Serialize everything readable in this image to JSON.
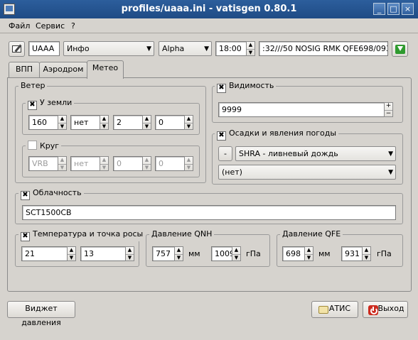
{
  "window": {
    "title": "profiles/uaaa.ini - vatisgen 0.80.1",
    "min": "_",
    "max": "□",
    "close": "×"
  },
  "menu": [
    {
      "label": "Файл"
    },
    {
      "label": "Сервис"
    },
    {
      "label": "?"
    }
  ],
  "toolbar": {
    "icao": "UAAA",
    "info": "Инфо",
    "alpha": "Alpha",
    "time": "18:00",
    "metar": ":32///50 NOSIG RMK QFE698/0931"
  },
  "tabs": [
    {
      "label": "ВПП"
    },
    {
      "label": "Аэродром"
    },
    {
      "label": "Метео"
    }
  ],
  "wind": {
    "title": "Ветер",
    "ground": {
      "label": "У земли",
      "checked": "✖",
      "dir": "160",
      "var": "нет",
      "speed": "2",
      "gust": "0"
    },
    "circle": {
      "label": "Круг",
      "dir": "VRB",
      "var": "нет",
      "speed": "0",
      "gust": "0"
    }
  },
  "visibility": {
    "label": "Видимость",
    "checked": "✖",
    "value": "9999"
  },
  "weather": {
    "label": "Осадки и явления погоды",
    "checked": "✖",
    "intensity": "-",
    "phenomenon": "SHRA - ливневый дождь",
    "second": "(нет)"
  },
  "clouds": {
    "label": "Облачность",
    "checked": "✖",
    "value": "SCT1500CB"
  },
  "temp": {
    "label": "Температура и точка росы",
    "checked": "✖",
    "temp": "21",
    "dew": "13"
  },
  "qnh": {
    "label": "Давление QNH",
    "mm": "757",
    "mm_unit": "мм",
    "hpa": "1009",
    "hpa_unit": "гПа"
  },
  "qfe": {
    "label": "Давление QFE",
    "mm": "698",
    "mm_unit": "мм",
    "hpa": "931",
    "hpa_unit": "гПа"
  },
  "buttons": {
    "widget": "Виджет давления",
    "atis": "АТИС",
    "exit": "Выход"
  },
  "spin": {
    "up": "▲",
    "down": "▼",
    "plus": "+",
    "minus": "−"
  },
  "arrow": "▼",
  "colors": {
    "titlebar": "#2c5e9c",
    "window_bg": "#d6d3ce",
    "exit_icon": "#cc2a1e",
    "go_icon": "#2e9a2e"
  }
}
